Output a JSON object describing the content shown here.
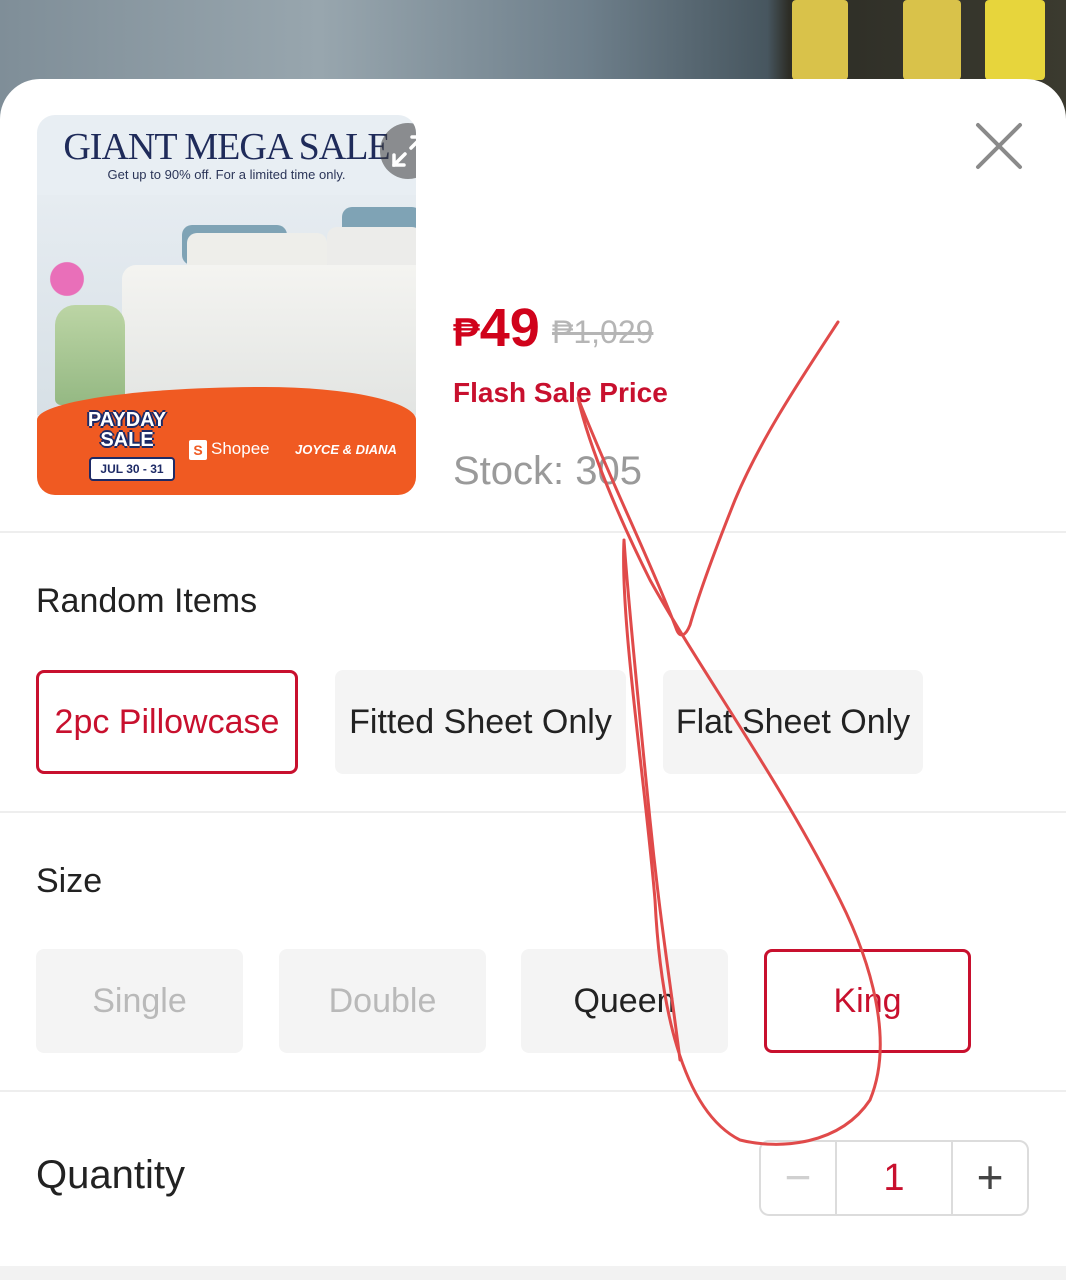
{
  "product": {
    "image": {
      "title": "GIANT MEGA SALE",
      "subtitle": "Get up to 90% off. For a limited time only.",
      "promo_line1": "PAYDAY",
      "promo_line2": "SALE",
      "promo_dates": "JUL 30 - 31",
      "shopee": "Shopee",
      "brand": "JOYCE & DIANA"
    },
    "price_currency": "₱",
    "price": "49",
    "original_price": "₱1,029",
    "flash_label": "Flash Sale Price",
    "stock_text": "Stock: 305"
  },
  "variation": {
    "label": "Random Items",
    "options": [
      "2pc Pillowcase",
      "Fitted Sheet Only",
      "Flat Sheet Only"
    ],
    "selected": "2pc Pillowcase"
  },
  "size": {
    "label": "Size",
    "options": [
      "Single",
      "Double",
      "Queen",
      "King"
    ],
    "disabled": [
      "Single",
      "Double"
    ],
    "selected": "King"
  },
  "quantity": {
    "label": "Quantity",
    "minus": "−",
    "value": "1",
    "plus": "+"
  },
  "colors": {
    "accent": "#c8102e",
    "price": "#d0021b",
    "annotation_stroke": "#e04a4a"
  },
  "icons": {
    "close": "close-icon",
    "expand": "expand-icon"
  }
}
